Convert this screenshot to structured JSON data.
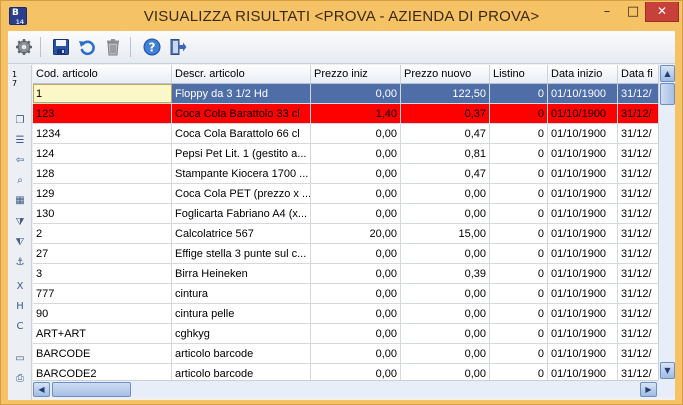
{
  "window": {
    "title": "VISUALIZZA RISULTATI <PROVA - AZIENDA DI PROVA>",
    "app_icon_text": "B",
    "app_icon_sub": "14",
    "minimize": "–",
    "maximize": "□",
    "close": "✕"
  },
  "toolbar": {
    "icons": [
      "settings-icon",
      "save-icon",
      "undo-icon",
      "delete-icon",
      "help-icon",
      "exit-icon"
    ]
  },
  "sidebar": {
    "count_line1": "1",
    "count_line2": "7",
    "icons": [
      "copy-icon",
      "list-icon",
      "export-icon",
      "search-icon",
      "calendar-icon",
      "filter-icon",
      "filter-remove-icon",
      "anchor-icon",
      "export-excel-icon",
      "export-html-icon",
      "export-csv-icon",
      "monitor-icon",
      "printer-icon"
    ]
  },
  "grid": {
    "columns": [
      "Cod. articolo",
      "Descr. articolo",
      "Prezzo iniz",
      "Prezzo nuovo",
      "Listino",
      "Data inizio",
      "Data fi"
    ],
    "rows": [
      [
        "1",
        "Floppy da 3 1/2 Hd",
        "0,00",
        "122,50",
        "0",
        "01/10/1900",
        "31/12/"
      ],
      [
        "123",
        "Coca Cola Barattolo 33 cl",
        "1,40",
        "0,37",
        "0",
        "01/10/1900",
        "31/12/"
      ],
      [
        "1234",
        "Coca Cola Barattolo 66 cl",
        "0,00",
        "0,47",
        "0",
        "01/10/1900",
        "31/12/"
      ],
      [
        "124",
        "Pepsi Pet Lit. 1 (gestito a...",
        "0,00",
        "0,81",
        "0",
        "01/10/1900",
        "31/12/"
      ],
      [
        "128",
        "Stampante Kiocera 1700 ...",
        "0,00",
        "0,47",
        "0",
        "01/10/1900",
        "31/12/"
      ],
      [
        "129",
        "Coca Cola PET (prezzo x ...",
        "0,00",
        "0,00",
        "0",
        "01/10/1900",
        "31/12/"
      ],
      [
        "130",
        "Foglicarta Fabriano A4 (x...",
        "0,00",
        "0,00",
        "0",
        "01/10/1900",
        "31/12/"
      ],
      [
        "2",
        "Calcolatrice 567",
        "20,00",
        "15,00",
        "0",
        "01/10/1900",
        "31/12/"
      ],
      [
        "27",
        "Effige stella 3 punte sul c...",
        "0,00",
        "0,00",
        "0",
        "01/10/1900",
        "31/12/"
      ],
      [
        "3",
        "Birra Heineken",
        "0,00",
        "0,39",
        "0",
        "01/10/1900",
        "31/12/"
      ],
      [
        "777",
        "cintura",
        "0,00",
        "0,00",
        "0",
        "01/10/1900",
        "31/12/"
      ],
      [
        "90",
        "cintura pelle",
        "0,00",
        "0,00",
        "0",
        "01/10/1900",
        "31/12/"
      ],
      [
        "ART+ART",
        "cghkyg",
        "0,00",
        "0,00",
        "0",
        "01/10/1900",
        "31/12/"
      ],
      [
        "BARCODE",
        "articolo barcode",
        "0,00",
        "0,00",
        "0",
        "01/10/1900",
        "31/12/"
      ],
      [
        "BARCODE2",
        "articolo barcode",
        "0,00",
        "0,00",
        "0",
        "01/10/1900",
        "31/12/"
      ]
    ],
    "selected_row": 0,
    "highlighted_row": 1,
    "highlight_color": "#ff0000",
    "selection_color": "#4f6da6"
  },
  "scroll": {
    "up": "▲",
    "down": "▼",
    "left": "◀",
    "right": "▶"
  }
}
